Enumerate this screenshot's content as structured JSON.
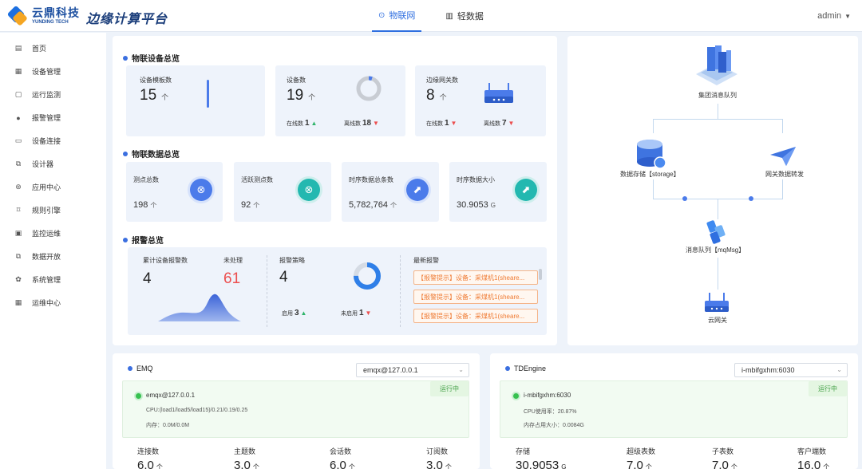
{
  "header": {
    "brand_cn": "云鼎科技",
    "brand_en": "YUNDING TECH",
    "platform": "边缘计算平台",
    "tabs": [
      {
        "label": "物联网",
        "active": true
      },
      {
        "label": "轻数据",
        "active": false
      }
    ],
    "user": "admin"
  },
  "sidebar": {
    "items": [
      {
        "label": "首页",
        "icon": "document-icon",
        "glyph": "▤"
      },
      {
        "label": "设备管理",
        "icon": "grid-icon",
        "glyph": "▦"
      },
      {
        "label": "运行监测",
        "icon": "file-icon",
        "glyph": "▢"
      },
      {
        "label": "报警管理",
        "icon": "bell-icon",
        "glyph": "●"
      },
      {
        "label": "设备连接",
        "icon": "link-icon",
        "glyph": "▭"
      },
      {
        "label": "设计器",
        "icon": "design-icon",
        "glyph": "⧉"
      },
      {
        "label": "应用中心",
        "icon": "app-icon",
        "glyph": "⊛"
      },
      {
        "label": "规则引擎",
        "icon": "rule-icon",
        "glyph": "⌑"
      },
      {
        "label": "监控运维",
        "icon": "monitor-icon",
        "glyph": "▣"
      },
      {
        "label": "数据开放",
        "icon": "open-icon",
        "glyph": "⧉"
      },
      {
        "label": "系统管理",
        "icon": "gear-icon",
        "glyph": "✿"
      },
      {
        "label": "运维中心",
        "icon": "table-icon",
        "glyph": "▦"
      }
    ]
  },
  "iot_devices": {
    "title": "物联设备总览",
    "template": {
      "label": "设备模板数",
      "value": "15",
      "unit": "个"
    },
    "devices": {
      "label": "设备数",
      "value": "19",
      "unit": "个",
      "online_label": "在线数",
      "online": "1",
      "offline_label": "离线数",
      "offline": "18",
      "online_ratio": 0.05
    },
    "gateways": {
      "label": "边缘网关数",
      "value": "8",
      "unit": "个",
      "online_label": "在线数",
      "online": "1",
      "offline_label": "离线数",
      "offline": "7"
    }
  },
  "iot_data": {
    "title": "物联数据总览",
    "cards": [
      {
        "label": "测点总数",
        "value": "198",
        "unit": "个",
        "icon": "network-icon",
        "color": "#4b7bea"
      },
      {
        "label": "活跃测点数",
        "value": "92",
        "unit": "个",
        "icon": "network-icon",
        "color": "#23b8b0"
      },
      {
        "label": "时序数据总条数",
        "value": "5,782,764",
        "unit": "个",
        "icon": "chart-icon",
        "color": "#4b7bea"
      },
      {
        "label": "时序数据大小",
        "value": "30.9053",
        "unit": "G",
        "icon": "chart-icon",
        "color": "#23b8b0"
      }
    ]
  },
  "alarms": {
    "title": "报警总览",
    "total_label": "累计设备报警数",
    "total": "4",
    "unhandled_label": "未处理",
    "unhandled": "61",
    "policy_label": "报警策略",
    "policy": "4",
    "enabled_label": "启用",
    "enabled": "3",
    "disabled_label": "未启用",
    "disabled": "1",
    "enabled_ratio": 0.75,
    "latest_label": "最新报警",
    "latest": [
      "【报警提示】设备：采煤机1(sheare...",
      "【报警提示】设备：采煤机1(sheare...",
      "【报警提示】设备：采煤机1(sheare..."
    ]
  },
  "topology": {
    "cluster": "集团消息队列",
    "storage": "数据存储【storage】",
    "forward": "网关数据转发",
    "mq": "消息队列【mqMsg】",
    "cloud": "云网关"
  },
  "emq": {
    "title": "EMQ",
    "select": "emqx@127.0.0.1",
    "status": "运行中",
    "node": "emqx@127.0.0.1",
    "cpu": "CPU:(load1/load5/load15)/0.21/0.19/0.25",
    "mem": "内存：0.0M/0.0M",
    "stats": [
      {
        "label": "连接数",
        "value": "6.0",
        "unit": "个"
      },
      {
        "label": "主题数",
        "value": "3.0",
        "unit": "个"
      },
      {
        "label": "会话数",
        "value": "6.0",
        "unit": "个"
      },
      {
        "label": "订阅数",
        "value": "3.0",
        "unit": "个"
      }
    ]
  },
  "tdengine": {
    "title": "TDEngine",
    "select": "i-mbifgxhm:6030",
    "status": "运行中",
    "node": "i-mbifgxhm:6030",
    "cpu": "CPU使用率：20.87%",
    "mem": "内存占用大小：0.0084G",
    "stats": [
      {
        "label": "存储",
        "value": "30.9053",
        "unit": "G"
      },
      {
        "label": "超级表数",
        "value": "7.0",
        "unit": "个"
      },
      {
        "label": "子表数",
        "value": "7.0",
        "unit": "个"
      },
      {
        "label": "客户端数",
        "value": "16.0",
        "unit": "个"
      }
    ]
  },
  "colors": {
    "accent": "#2f6fe0",
    "up": "#2fb46a",
    "down": "#ec4f4f",
    "warn": "#ef7a32"
  }
}
